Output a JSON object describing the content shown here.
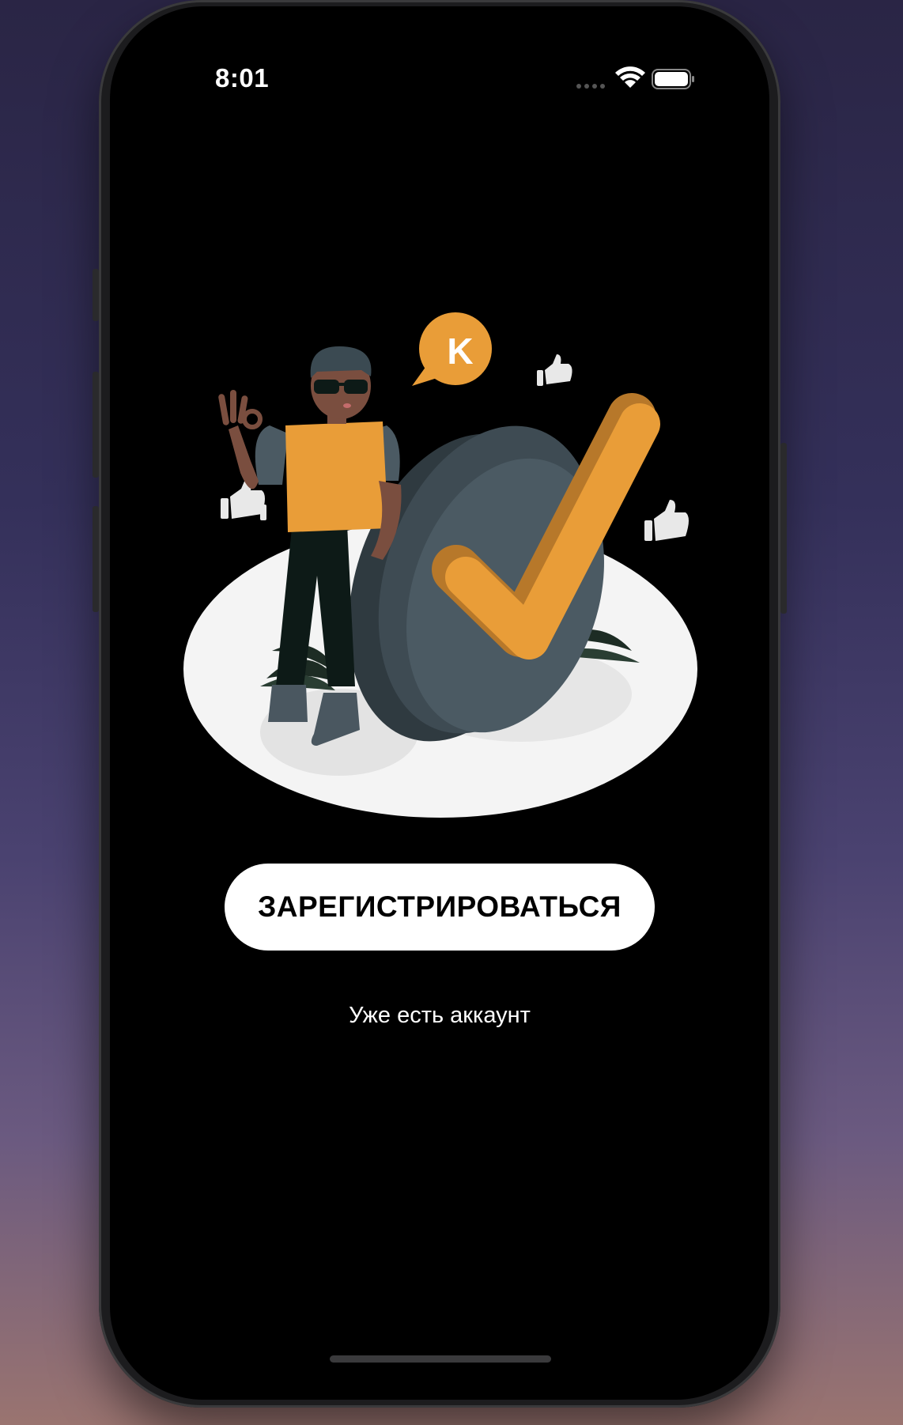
{
  "status_bar": {
    "time": "8:01",
    "signal_icon": "cellular-dots-icon",
    "wifi_icon": "wifi-icon",
    "battery_icon": "battery-icon"
  },
  "illustration": {
    "bubble_letter": "K"
  },
  "actions": {
    "register_label": "ЗАРЕГИСТРИРОВАТЬСЯ",
    "login_label": "Уже есть аккаунт"
  },
  "colors": {
    "screen_bg": "#000000",
    "accent_orange": "#E99D38",
    "button_bg": "#FFFFFF",
    "button_text": "#000000",
    "link_text": "#FFFFFF"
  }
}
